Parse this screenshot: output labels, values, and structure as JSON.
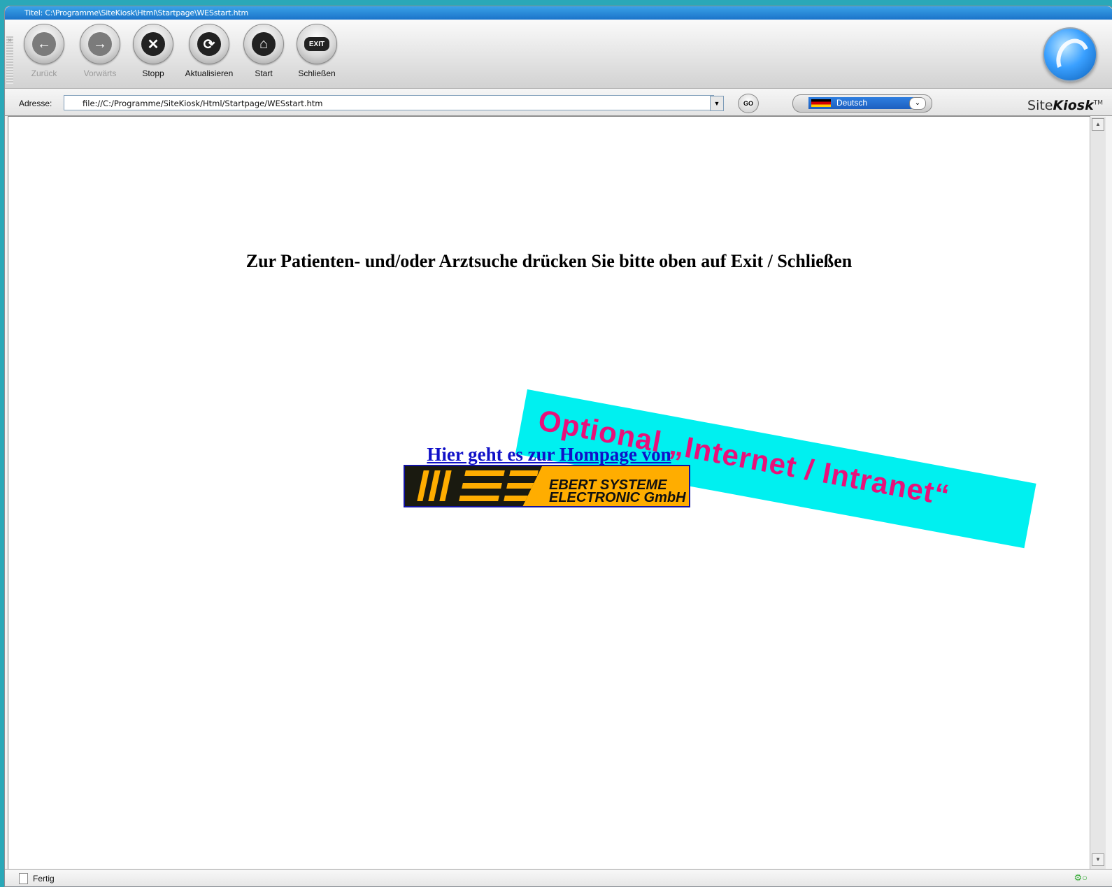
{
  "window": {
    "title": "Titel: C:\\Programme\\SiteKiosk\\Html\\Startpage\\WESstart.htm"
  },
  "toolbar": {
    "buttons": [
      {
        "label": "Zurück",
        "icon": "back-arrow-icon",
        "glyph": "←",
        "enabled": false
      },
      {
        "label": "Vorwärts",
        "icon": "forward-arrow-icon",
        "glyph": "→",
        "enabled": false
      },
      {
        "label": "Stopp",
        "icon": "stop-icon",
        "glyph": "✕",
        "enabled": true
      },
      {
        "label": "Aktualisieren",
        "icon": "refresh-icon",
        "glyph": "⟳",
        "enabled": true
      },
      {
        "label": "Start",
        "icon": "home-icon",
        "glyph": "⌂",
        "enabled": true
      },
      {
        "label": "Schließen",
        "icon": "exit-icon",
        "glyph": "EXIT",
        "enabled": true
      }
    ]
  },
  "address": {
    "label": "Adresse:",
    "value": "file://C:/Programme/SiteKiosk/Html/Startpage/WESstart.htm",
    "go_label": "GO"
  },
  "language": {
    "selected": "Deutsch"
  },
  "brand": {
    "prefix": "Site",
    "name": "Kiosk",
    "tm": "TM"
  },
  "page": {
    "heading": "Zur Patienten- und/oder Arztsuche drücken Sie bitte oben auf Exit / Schließen",
    "banner": "Optional „Internet / Intranet“",
    "homepage_link": "Hier geht es zur Hompage von",
    "logo": {
      "line1": "EBERT SYSTEME",
      "line2": "ELECTRONIC GmbH"
    }
  },
  "status": {
    "text": "Fertig"
  },
  "colors": {
    "banner_bg": "#00f0f0",
    "banner_text": "#e8107a",
    "link": "#1010c8",
    "logo_bg": "#ffad00"
  }
}
